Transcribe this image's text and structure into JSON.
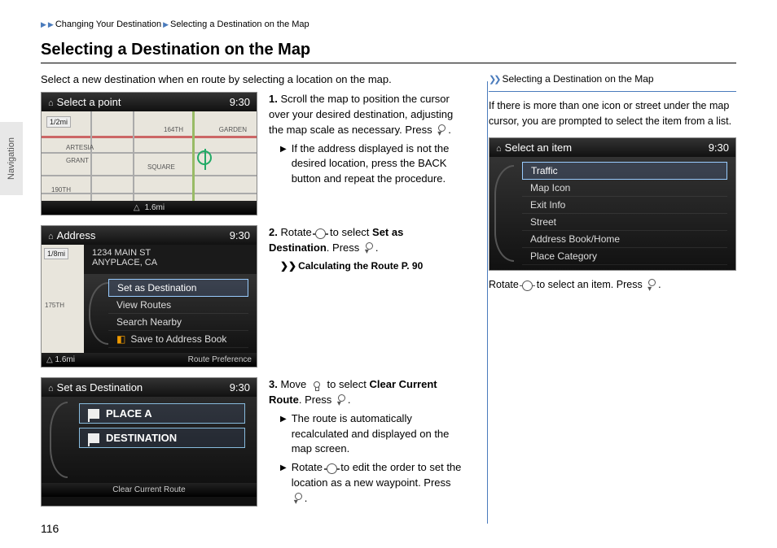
{
  "breadcrumb": {
    "a": "Changing Your Destination",
    "b": "Selecting a Destination on the Map"
  },
  "title": "Selecting a Destination on the Map",
  "intro": "Select a new destination when en route by selecting a location on the map.",
  "sideTab": "Navigation",
  "pageNumber": "116",
  "clock": "9:30",
  "scr1": {
    "header": "Select a point",
    "scale": "1/2mi",
    "labels": {
      "a": "164TH",
      "b": "GARDEN",
      "c": "ARTESIA",
      "d": "GRANT",
      "e": "190TH",
      "f": "SQUARE"
    },
    "footer_dist": "1.6mi"
  },
  "scr2": {
    "header": "Address",
    "scale": "1/8mi",
    "addr1": "1234 MAIN ST",
    "addr2": "ANYPLACE, CA",
    "label_175": "175TH",
    "menu": {
      "a": "Set as Destination",
      "b": "View Routes",
      "c": "Search Nearby",
      "d": "Save to Address Book"
    },
    "footer_dist": "1.6mi",
    "footer_right": "Route Preference"
  },
  "scr3": {
    "header": "Set as Destination",
    "items": {
      "a": "PLACE A",
      "b": "DESTINATION"
    },
    "footer": "Clear Current Route"
  },
  "steps": {
    "s1": {
      "n": "1.",
      "t": "Scroll the map to position the cursor over your desired destination, adjusting the map scale as necessary. Press ",
      "t2": ".",
      "sub": "If the address displayed is not the desired location, press the BACK button and repeat the procedure."
    },
    "s2": {
      "n": "2.",
      "t1": "Rotate ",
      "t2": " to select ",
      "bold": "Set as Destination",
      "t3": ". Press ",
      "t4": ".",
      "ref": "Calculating the Route",
      "refpage": " P. 90"
    },
    "s3": {
      "n": "3.",
      "t1": "Move ",
      "t2": " to select ",
      "bold": "Clear Current Route",
      "t3": ". Press ",
      "t4": ".",
      "sub1": "The route is automatically recalculated and displayed on the map screen.",
      "sub2a": "Rotate ",
      "sub2b": " to edit the order to set the location as a new waypoint. Press ",
      "sub2c": "."
    }
  },
  "right": {
    "title": "Selecting a Destination on the Map",
    "note": "If there is more than one icon or street under the map cursor, you are prompted to select the item from a list.",
    "scr": {
      "header": "Select an item",
      "items": {
        "a": "Traffic",
        "b": "Map Icon",
        "c": "Exit Info",
        "d": "Street",
        "e": "Address Book/Home",
        "f": "Place Category"
      }
    },
    "caption1": "Rotate ",
    "caption2": " to select an item. Press ",
    "caption3": "."
  }
}
